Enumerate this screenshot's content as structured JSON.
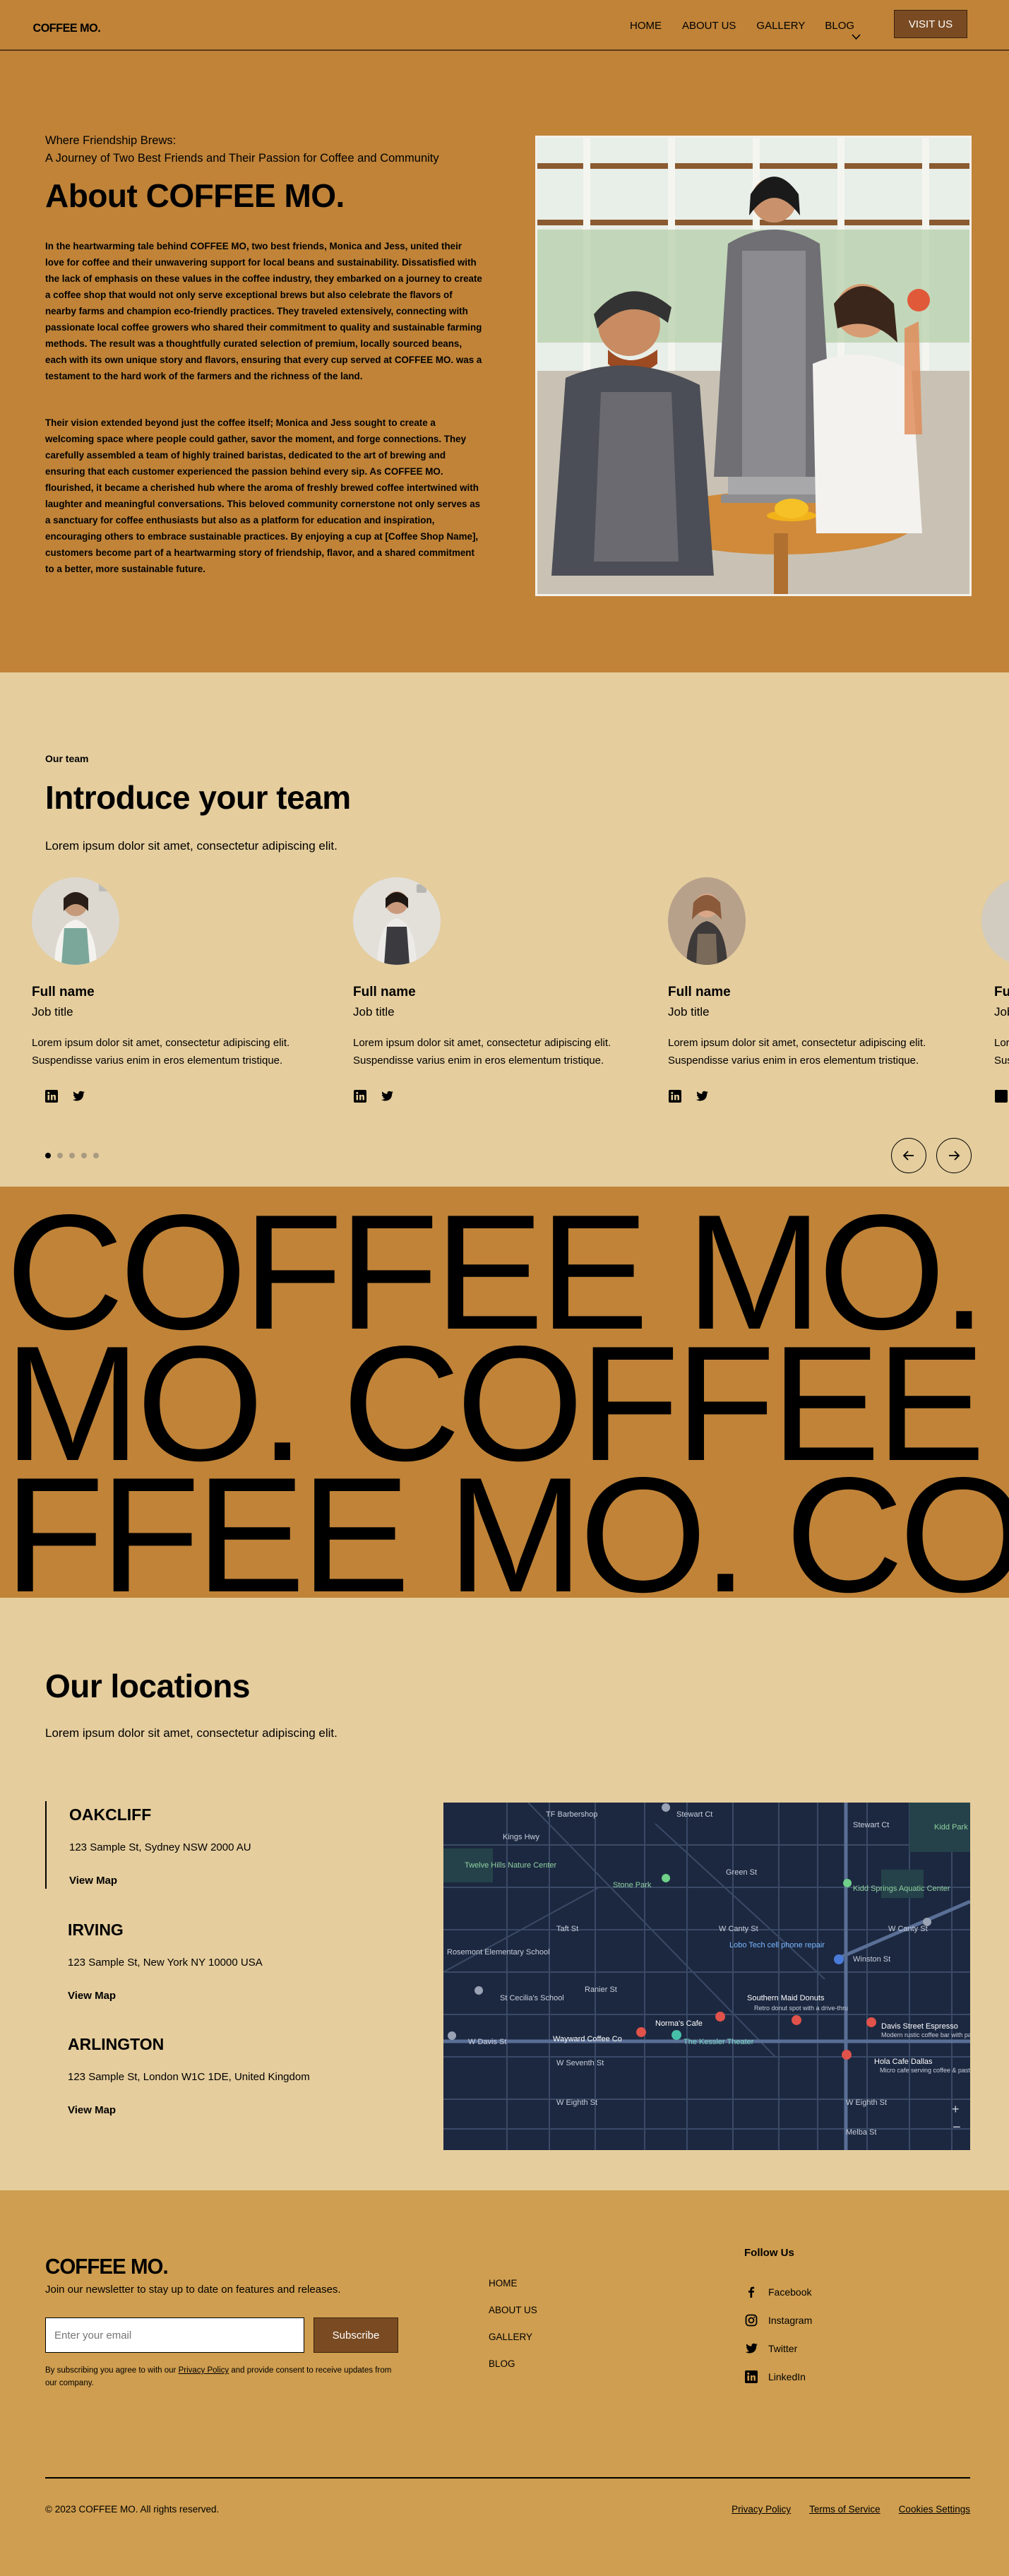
{
  "nav": {
    "logo": "COFFEE MO.",
    "links": [
      "HOME",
      "ABOUT US",
      "GALLERY",
      "BLOG"
    ],
    "cta": "VISIT US"
  },
  "about": {
    "tagline_1": "Where Friendship Brews:",
    "tagline_2": "A Journey of Two Best Friends and Their Passion for Coffee and Community",
    "title": "About COFFEE MO.",
    "paragraph_1": "In the heartwarming tale behind COFFEE MO, two best friends, Monica and Jess, united their love for coffee and their unwavering support for local beans and sustainability. Dissatisfied with the lack of emphasis on these values in the coffee industry, they embarked on a journey to create a coffee shop that would not only serve exceptional brews but also celebrate the flavors of nearby farms and champion eco-friendly practices. They traveled extensively, connecting with passionate local coffee growers who shared their commitment to quality and sustainable farming methods. The result was a thoughtfully curated selection of premium, locally sourced beans, each with its own unique story and flavors, ensuring that every cup served at COFFEE MO. was a testament to the hard work of the farmers and the richness of the land.",
    "paragraph_2": "Their vision extended beyond just the coffee itself; Monica and Jess sought to create a welcoming space where people could gather, savor the moment, and forge connections. They carefully assembled a team of highly trained baristas, dedicated to the art of brewing and ensuring that each customer experienced the passion behind every sip. As COFFEE MO. flourished, it became a cherished hub where the aroma of freshly brewed coffee intertwined with laughter and meaningful conversations. This beloved community cornerstone not only serves as a sanctuary for coffee enthusiasts but also as a platform for education and inspiration, encouraging others to embrace sustainable practices. By enjoying a cup at [Coffee Shop Name], customers become part of a heartwarming story of friendship, flavor, and a shared commitment to a better, more sustainable future."
  },
  "team": {
    "eyebrow": "Our team",
    "title": "Introduce your team",
    "lead": "Lorem ipsum dolor sit amet, consectetur adipiscing elit.",
    "members": [
      {
        "name": "Full name",
        "role": "Job title",
        "bio": "Lorem ipsum dolor sit amet, consectetur adipiscing elit. Suspendisse varius enim in eros elementum tristique."
      },
      {
        "name": "Full name",
        "role": "Job title",
        "bio": "Lorem ipsum dolor sit amet, consectetur adipiscing elit. Suspendisse varius enim in eros elementum tristique."
      },
      {
        "name": "Full name",
        "role": "Job title",
        "bio": "Lorem ipsum dolor sit amet, consectetur adipiscing elit. Suspendisse varius enim in eros elementum tristique."
      },
      {
        "name": "Full name",
        "role": "Job title",
        "bio": "Lorem ipsum dolor sit amet, consectetur adipiscing elit. Suspendisse varius enim in eros elementum tristique."
      }
    ],
    "slide_count": 5,
    "active_slide": 1
  },
  "marquee": {
    "row_1": "COFFEE MO. COFFEE MO.",
    "row_2": "MO. COFFEE MO. COFFEE",
    "row_3": "FFEE MO. COFFEE MO."
  },
  "locations": {
    "title": "Our locations",
    "lead": "Lorem ipsum dolor sit amet, consectetur adipiscing elit.",
    "sites": [
      {
        "name": "OAKCLIFF",
        "address": "123 Sample St, Sydney NSW 2000 AU",
        "link": "View Map"
      },
      {
        "name": "IRVING",
        "address": "123 Sample St, New York NY 10000 USA",
        "link": "View Map"
      },
      {
        "name": "ARLINGTON",
        "address": "123 Sample St, London W1C 1DE, United Kingdom",
        "link": "View Map"
      }
    ],
    "map_labels": {
      "a": "TF Barbershop",
      "b": "Stewart Ct",
      "c": "Kings Hwy",
      "d": "Twelve Hills Nature Center",
      "e": "Stone Park",
      "f": "Green St",
      "g": "Kidd Springs Aquatic Center",
      "h": "Taft St",
      "i": "W Canty St",
      "j": "Rosemont Elementary School",
      "k": "Lobo Tech cell phone repair",
      "l": "Winston St",
      "m": "Ranier St",
      "n": "St Cecilia's School",
      "o": "Southern Maid Donuts",
      "p": "Retro donut spot with a drive-thru",
      "q": "Norma's Cafe",
      "r": "Davis Street Espresso",
      "s": "Modern rustic coffee bar with pastries",
      "t": "W Davis St",
      "u": "Wayward Coffee Co",
      "v": "The Kessler Theater",
      "w": "W Seventh St",
      "x": "Hola Cafe Dallas",
      "y": "Micro cafe serving coffee & pastries",
      "z": "W Eighth St",
      "aa": "Melba St",
      "ab": "Kidd Park Play"
    }
  },
  "footer": {
    "logo": "COFFEE MO.",
    "newsletter": "Join our newsletter to stay up to date on features and releases.",
    "email_placeholder": "Enter your email",
    "subscribe": "Subscribe",
    "fine_1": "By subscribing you agree to with our ",
    "fine_link": "Privacy Policy",
    "fine_2": " and provide consent to receive updates from our company.",
    "nav": [
      "HOME",
      "ABOUT US",
      "GALLERY",
      "BLOG"
    ],
    "follow_title": "Follow Us",
    "socials": [
      "Facebook",
      "Instagram",
      "Twitter",
      "LinkedIn"
    ],
    "copyright": "© 2023 COFFEE MO. All rights reserved.",
    "legal": [
      "Privacy Policy",
      "Terms of Service",
      "Cookies Settings"
    ]
  }
}
